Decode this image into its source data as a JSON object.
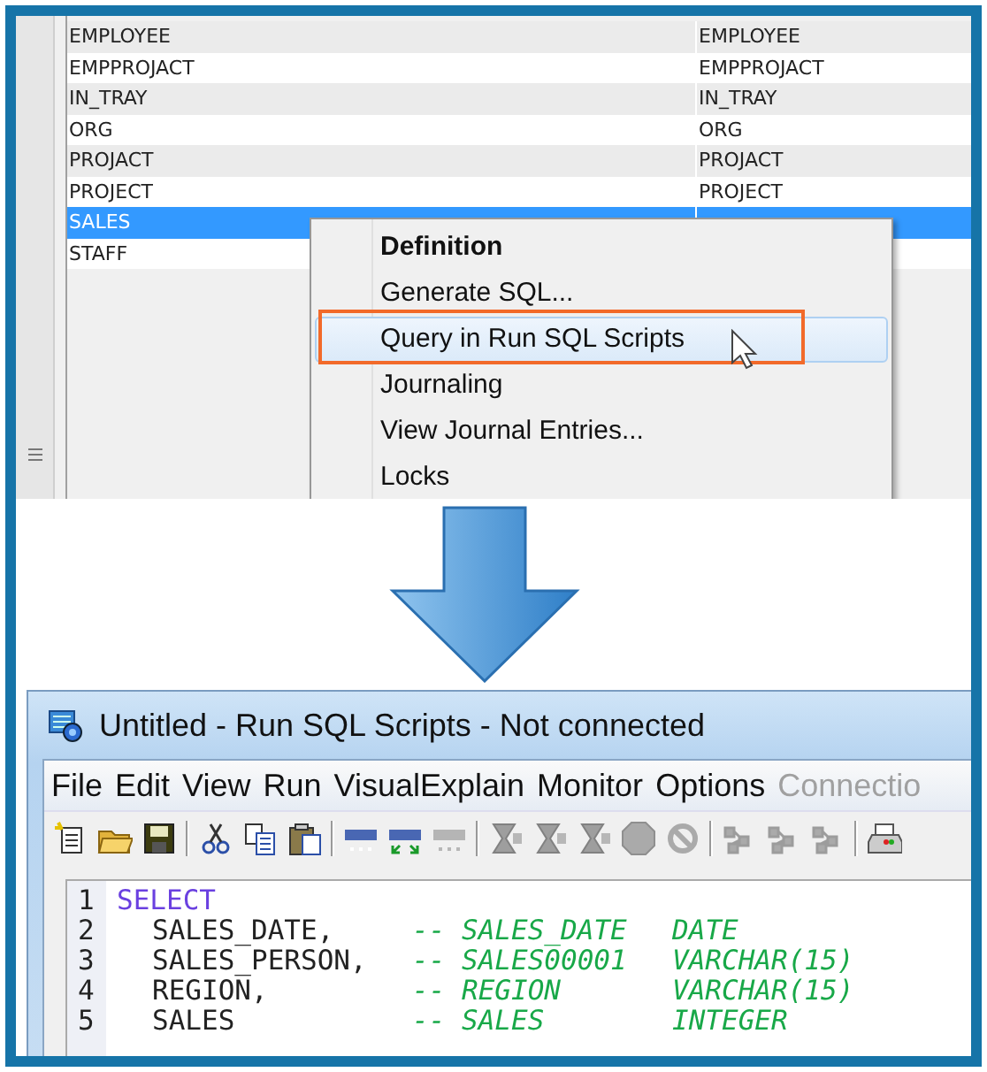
{
  "table": {
    "rows": [
      {
        "name": "EMPLOYEE",
        "column_2": "EMPLOYEE",
        "selected": false
      },
      {
        "name": "EMPPROJACT",
        "column_2": "EMPPROJACT",
        "selected": false
      },
      {
        "name": "IN_TRAY",
        "column_2": "IN_TRAY",
        "selected": false
      },
      {
        "name": "ORG",
        "column_2": "ORG",
        "selected": false
      },
      {
        "name": "PROJACT",
        "column_2": "PROJACT",
        "selected": false
      },
      {
        "name": "PROJECT",
        "column_2": "PROJECT",
        "selected": false
      },
      {
        "name": "SALES",
        "selected": true
      },
      {
        "name": "STAFF",
        "selected": false
      }
    ]
  },
  "context_menu": {
    "items": [
      {
        "label": "Definition",
        "default": true,
        "hovered": false,
        "callout": false
      },
      {
        "label": "Generate SQL...",
        "default": false,
        "hovered": false,
        "callout": false
      },
      {
        "label": "Query in Run SQL Scripts",
        "default": false,
        "hovered": true,
        "callout": true
      },
      {
        "label": "Journaling",
        "default": false,
        "hovered": false,
        "callout": false
      },
      {
        "label": "View Journal Entries...",
        "default": false,
        "hovered": false,
        "callout": false
      },
      {
        "label": "Locks",
        "default": false,
        "hovered": false,
        "callout": false
      }
    ]
  },
  "window": {
    "title": "Untitled - Run SQL Scripts - Not connected",
    "menu": [
      {
        "label": "File",
        "disabled": false
      },
      {
        "label": "Edit",
        "disabled": false
      },
      {
        "label": "View",
        "disabled": false
      },
      {
        "label": "Run",
        "disabled": false
      },
      {
        "label": "VisualExplain",
        "disabled": false
      },
      {
        "label": "Monitor",
        "disabled": false
      },
      {
        "label": "Options",
        "disabled": false
      },
      {
        "label": "Connectio",
        "disabled": true
      }
    ],
    "toolbar": [
      {
        "kind": "new",
        "disabled": false
      },
      {
        "kind": "open",
        "disabled": false
      },
      {
        "kind": "save",
        "disabled": false
      },
      {
        "kind": "separator"
      },
      {
        "kind": "cut",
        "disabled": false
      },
      {
        "kind": "copy",
        "disabled": false
      },
      {
        "kind": "paste",
        "disabled": false
      },
      {
        "kind": "separator"
      },
      {
        "kind": "sql",
        "disabled": false
      },
      {
        "kind": "sql-step",
        "disabled": false
      },
      {
        "kind": "sql",
        "disabled": true
      },
      {
        "kind": "separator"
      },
      {
        "kind": "hourglass",
        "disabled": true
      },
      {
        "kind": "hourglass",
        "disabled": true
      },
      {
        "kind": "hourglass",
        "disabled": true
      },
      {
        "kind": "stop",
        "disabled": true
      },
      {
        "kind": "cancel",
        "disabled": true
      },
      {
        "kind": "separator"
      },
      {
        "kind": "graph",
        "disabled": true
      },
      {
        "kind": "graph",
        "disabled": true
      },
      {
        "kind": "graph",
        "disabled": true
      },
      {
        "kind": "separator"
      },
      {
        "kind": "print",
        "disabled": false
      }
    ],
    "editor": {
      "lines": [
        {
          "number": "1",
          "kind": "keyword",
          "code": "SELECT"
        },
        {
          "number": "2",
          "kind": "column",
          "code": "SALES_DATE,",
          "comment": "-- SALES_DATE",
          "type": "DATE"
        },
        {
          "number": "3",
          "kind": "column",
          "code": "SALES_PERSON,",
          "comment": "-- SALES00001",
          "type": "VARCHAR(15)"
        },
        {
          "number": "4",
          "kind": "column",
          "code": "REGION,",
          "comment": "-- REGION",
          "type": "VARCHAR(15)"
        },
        {
          "number": "5",
          "kind": "column",
          "code": "SALES",
          "comment": "-- SALES",
          "type": "INTEGER"
        }
      ]
    }
  }
}
